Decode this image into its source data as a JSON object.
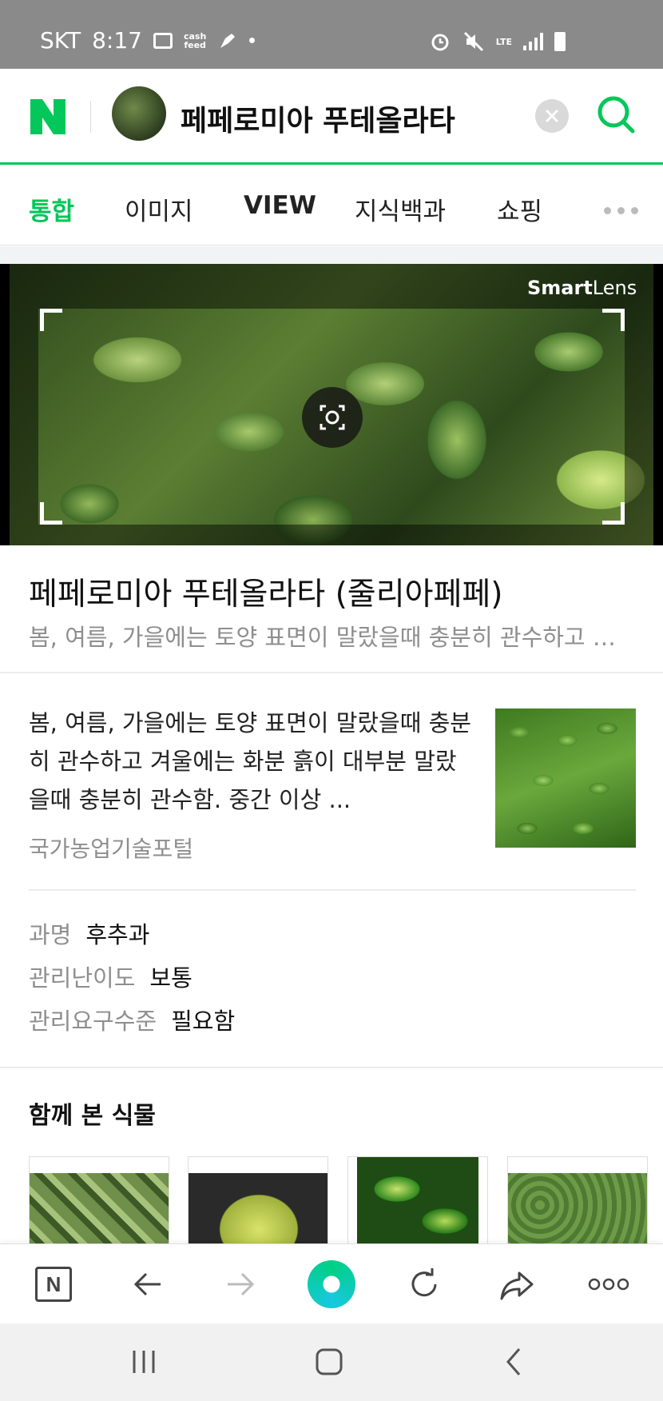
{
  "status_bar": {
    "carrier": "SKT",
    "time": "8:17",
    "cash_label": "cash\nfeed",
    "network": "LTE"
  },
  "search": {
    "query": "페페로미아 푸테올라타"
  },
  "tabs": [
    {
      "label": "통합"
    },
    {
      "label": "이미지"
    },
    {
      "label": "VIEW"
    },
    {
      "label": "지식백과"
    },
    {
      "label": "쇼핑"
    }
  ],
  "lens": {
    "brand_bold": "Smart",
    "brand_light": "Lens"
  },
  "result": {
    "title": "페페로미아 푸테올라타 (줄리아페페)",
    "subtitle": "봄, 여름, 가을에는 토양 표면이 말랐을때 충분히 관수하고 겨...",
    "description": "봄, 여름, 가을에는 토양 표면이 말랐을때 충분히 관수하고 겨울에는 화분 흙이 대부분 말랐을때 충분히 관수함. 중간 이상 ...",
    "source": "국가농업기술포털"
  },
  "info": [
    {
      "key": "과명",
      "value": "후추과"
    },
    {
      "key": "관리난이도",
      "value": "보통"
    },
    {
      "key": "관리요구수준",
      "value": "필요함"
    }
  ],
  "related": {
    "title": "함께 본 식물"
  },
  "colors": {
    "brand_green": "#03c75a"
  }
}
